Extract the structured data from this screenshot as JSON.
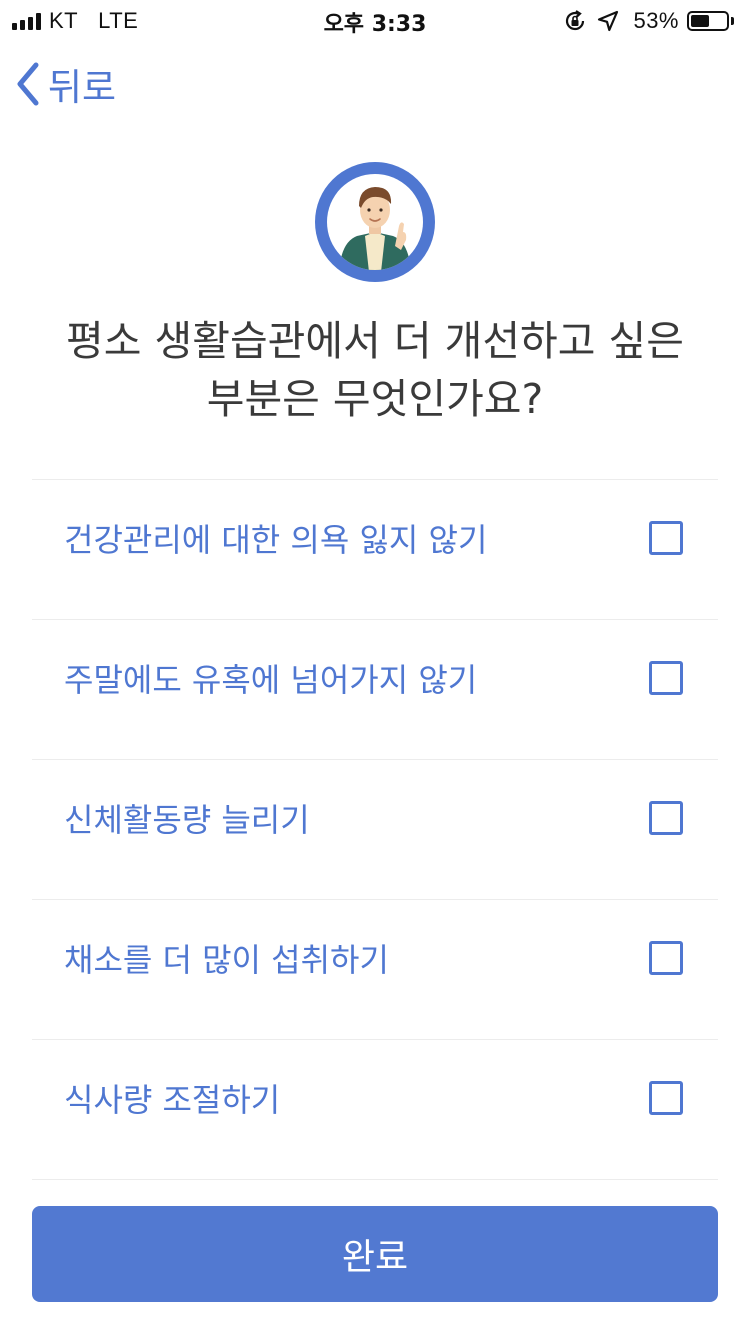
{
  "status_bar": {
    "carrier": "KT",
    "network": "LTE",
    "time": "오후 3:33",
    "battery_percent": "53%",
    "battery_level": 0.53,
    "icons": [
      "signal-icon",
      "orientation-lock-icon",
      "location-icon",
      "battery-icon"
    ]
  },
  "nav": {
    "back_label": "뒤로"
  },
  "question": {
    "line1": "평소 생활습관에서 더 개선하고 싶은",
    "line2": "부분은 무엇인가요?"
  },
  "options": [
    {
      "label": "건강관리에 대한 의욕 잃지 않기",
      "checked": false
    },
    {
      "label": "주말에도 유혹에 넘어가지 않기",
      "checked": false
    },
    {
      "label": "신체활동량 늘리기",
      "checked": false
    },
    {
      "label": "채소를 더 많이 섭취하기",
      "checked": false
    },
    {
      "label": "식사량 조절하기",
      "checked": false
    }
  ],
  "done_button": {
    "label": "완료"
  },
  "colors": {
    "accent": "#4f77d1",
    "button": "#5279d1",
    "divider": "#ececec",
    "question_text": "#3a3a3a"
  }
}
